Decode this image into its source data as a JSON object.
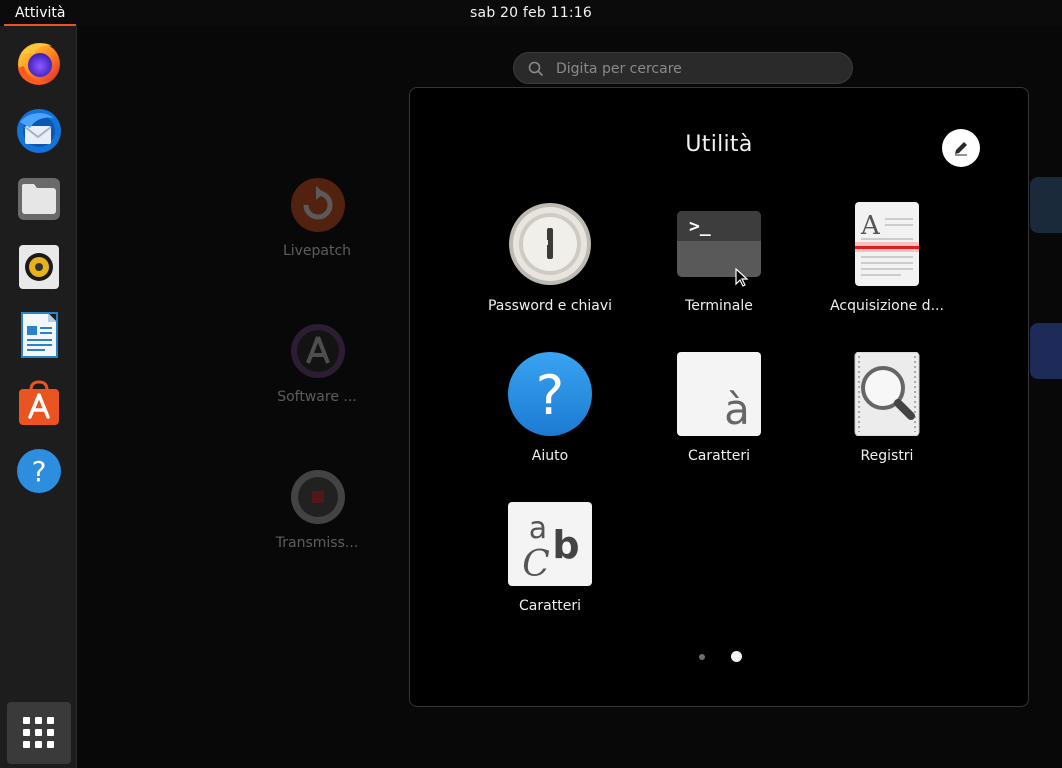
{
  "topbar": {
    "activities": "Attività",
    "clock": "sab 20 feb  11:16"
  },
  "dock": {
    "items": [
      {
        "icon": "firefox-icon"
      },
      {
        "icon": "thunderbird-icon"
      },
      {
        "icon": "files-icon"
      },
      {
        "icon": "rhythmbox-icon"
      },
      {
        "icon": "libreoffice-writer-icon"
      },
      {
        "icon": "ubuntu-software-icon"
      },
      {
        "icon": "help-icon"
      }
    ],
    "apps_button_icon": "app-grid-icon"
  },
  "search": {
    "placeholder": "Digita per cercare"
  },
  "background_apps": [
    {
      "label": "Livepatch"
    },
    {
      "label": "Software ..."
    },
    {
      "label": "Transmiss..."
    }
  ],
  "folder": {
    "title": "Utilità",
    "apps": [
      {
        "label": "Password e chiavi",
        "icon": "seahorse-icon"
      },
      {
        "label": "Terminale",
        "icon": "terminal-icon"
      },
      {
        "label": "Acquisizione d...",
        "icon": "document-scanner-icon"
      },
      {
        "label": "Aiuto",
        "icon": "help-icon"
      },
      {
        "label": "Caratteri",
        "icon": "character-map-icon"
      },
      {
        "label": "Registri",
        "icon": "logs-icon"
      },
      {
        "label": "Caratteri",
        "icon": "fonts-icon"
      }
    ],
    "pages": 2,
    "current_page": 2
  },
  "colors": {
    "accent": "#e95420",
    "panel": "#1d1d1d",
    "folder_bg": "#000000"
  }
}
